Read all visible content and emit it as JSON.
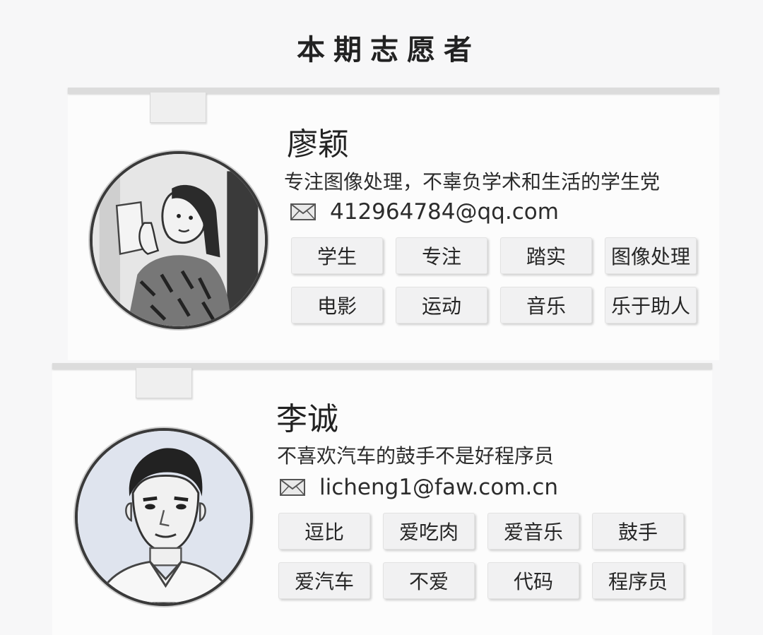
{
  "page": {
    "title": "本期志愿者"
  },
  "volunteers": [
    {
      "name": "廖颖",
      "bio": "专注图像处理，不辜负学术和生活的学生党",
      "email": "412964784@qq.com",
      "tags": [
        "学生",
        "专注",
        "踏实",
        "图像处理",
        "电影",
        "运动",
        "音乐",
        "乐于助人"
      ]
    },
    {
      "name": "李诚",
      "bio": "不喜欢汽车的鼓手不是好程序员",
      "email": "licheng1@faw.com.cn",
      "tags": [
        "逗比",
        "爱吃肉",
        "爱音乐",
        "鼓手",
        "爱汽车",
        "不爱",
        "代码",
        "程序员"
      ]
    }
  ],
  "icons": {
    "email": "envelope-icon"
  },
  "colors": {
    "background": "#f7f7f8",
    "card": "#fcfcfc",
    "tag": "#f1f1f2",
    "text": "#2a2a2a"
  }
}
